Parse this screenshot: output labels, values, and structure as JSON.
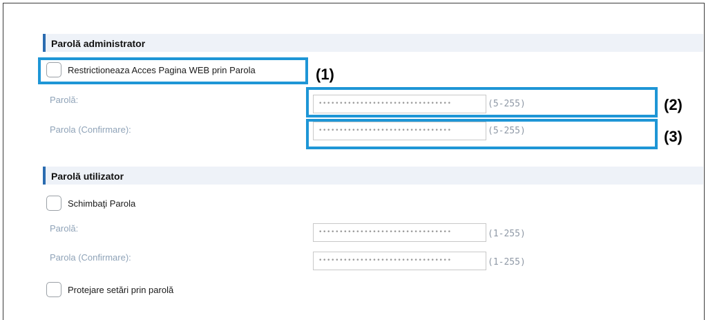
{
  "admin": {
    "heading": "Parolă administrator",
    "restrict_checkbox": {
      "label": "Restrictioneaza Acces Pagina WEB prin Parola",
      "checked": false
    },
    "password": {
      "label": "Parolă:",
      "value": "••••••••••••••••••••••••••••••••",
      "range": "(5-255)"
    },
    "confirm": {
      "label": "Parola (Confirmare):",
      "value": "••••••••••••••••••••••••••••••••",
      "range": "(5-255)"
    }
  },
  "user": {
    "heading": "Parolă utilizator",
    "change_checkbox": {
      "label": "Schimbaţi Parola",
      "checked": false
    },
    "password": {
      "label": "Parolă:",
      "value": "••••••••••••••••••••••••••••••••",
      "range": "(1-255)"
    },
    "confirm": {
      "label": "Parola (Confirmare):",
      "value": "••••••••••••••••••••••••••••••••",
      "range": "(1-255)"
    },
    "protect_checkbox": {
      "label": "Protejare setări prin parolă",
      "checked": false
    }
  },
  "callouts": {
    "one": "(1)",
    "two": "(2)",
    "three": "(3)"
  },
  "colors": {
    "highlight": "#1e96d6",
    "section_accent": "#2b6cb0",
    "section_bg": "#eef2f8",
    "muted_label": "#8fa3b8"
  }
}
